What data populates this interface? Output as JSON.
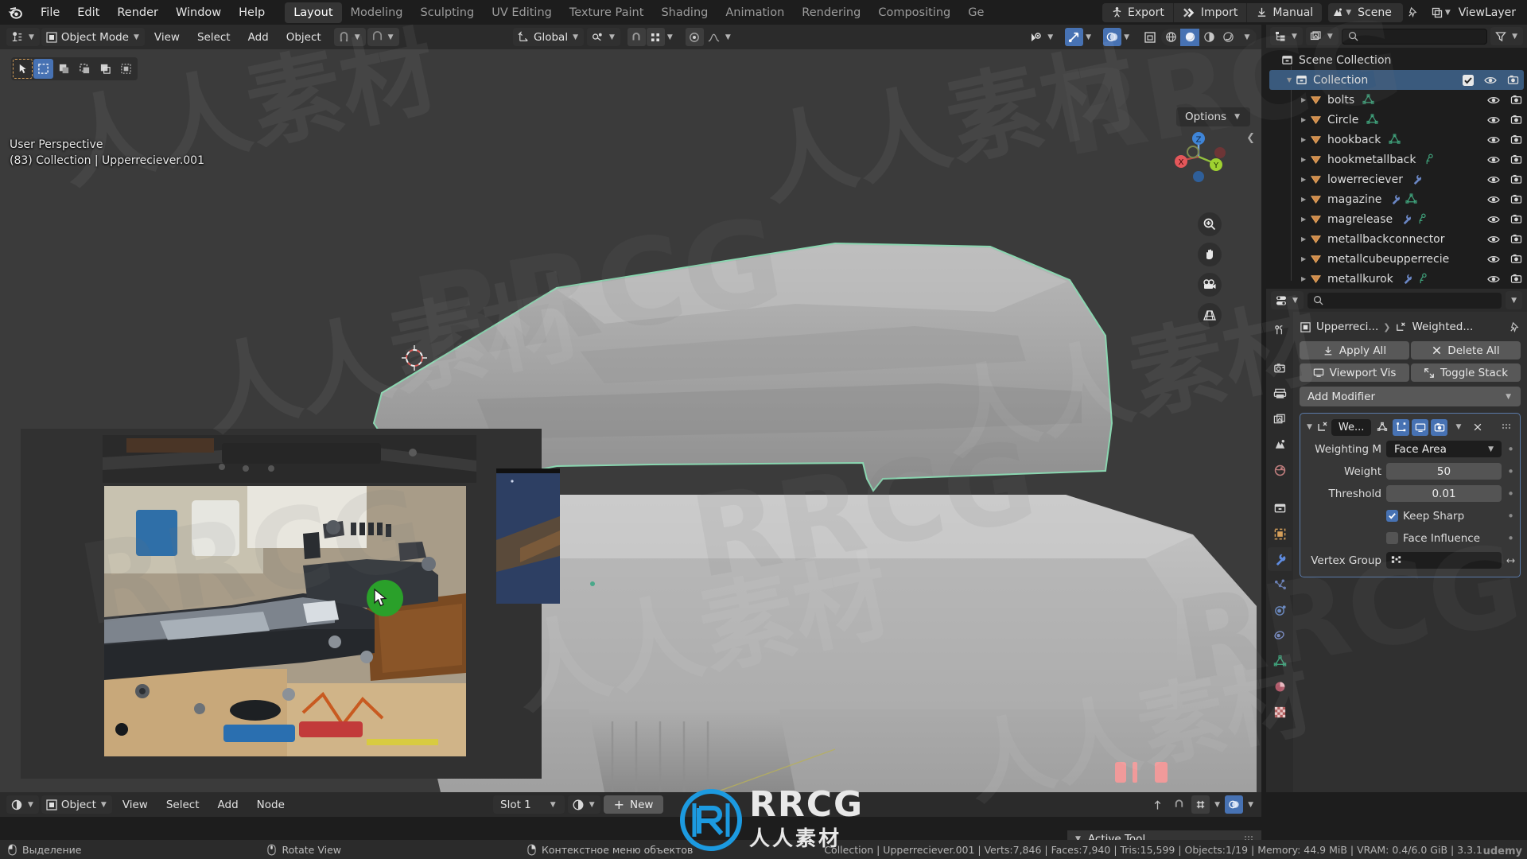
{
  "topbar": {
    "menus": [
      "File",
      "Edit",
      "Render",
      "Window",
      "Help"
    ],
    "workspaces": [
      {
        "label": "Layout",
        "active": true
      },
      {
        "label": "Modeling",
        "active": false
      },
      {
        "label": "Sculpting",
        "active": false
      },
      {
        "label": "UV Editing",
        "active": false
      },
      {
        "label": "Texture Paint",
        "active": false
      },
      {
        "label": "Shading",
        "active": false
      },
      {
        "label": "Animation",
        "active": false
      },
      {
        "label": "Rendering",
        "active": false
      },
      {
        "label": "Compositing",
        "active": false
      },
      {
        "label": "Ge",
        "active": false
      }
    ],
    "export_label": "Export",
    "import_label": "Import",
    "manual_label": "Manual",
    "scene_name": "Scene",
    "viewlayer_name": "ViewLayer",
    "logo_alt": "blender-logo"
  },
  "viewport_header": {
    "mode": "Object Mode",
    "menus": [
      "View",
      "Select",
      "Add",
      "Object"
    ],
    "transform_orientation": "Global",
    "options_label": "Options"
  },
  "viewport": {
    "perspective_label": "User Perspective",
    "scene_object_label": "(83) Collection | Upperreciever.001"
  },
  "outliner": {
    "scene_collection": "Scene Collection",
    "items": [
      {
        "label": "Collection",
        "indent": 0,
        "expanded": true,
        "checkbox": true,
        "type": "collection",
        "icons": [],
        "eye": true,
        "camera": true
      },
      {
        "label": "bolts",
        "indent": 1,
        "expanded": false,
        "type": "object",
        "icons": [
          "mesh"
        ],
        "eye": true,
        "camera": true
      },
      {
        "label": "Circle",
        "indent": 1,
        "expanded": false,
        "type": "object",
        "icons": [
          "mesh"
        ],
        "eye": true,
        "camera": true
      },
      {
        "label": "hookback",
        "indent": 1,
        "expanded": false,
        "type": "object",
        "icons": [
          "mesh"
        ],
        "eye": true,
        "camera": true
      },
      {
        "label": "hookmetallback",
        "indent": 1,
        "expanded": false,
        "type": "object",
        "icons": [
          "mod"
        ],
        "eye": true,
        "camera": true
      },
      {
        "label": "lowerreciever",
        "indent": 1,
        "expanded": false,
        "type": "object",
        "icons": [
          "wrench"
        ],
        "eye": true,
        "camera": true
      },
      {
        "label": "magazine",
        "indent": 1,
        "expanded": false,
        "type": "object",
        "icons": [
          "wrench",
          "mesh"
        ],
        "eye": true,
        "camera": true
      },
      {
        "label": "magrelease",
        "indent": 1,
        "expanded": false,
        "type": "object",
        "icons": [
          "wrench",
          "mod"
        ],
        "eye": true,
        "camera": true
      },
      {
        "label": "metallbackconnector",
        "indent": 1,
        "expanded": false,
        "type": "object",
        "icons": [],
        "eye": true,
        "camera": true
      },
      {
        "label": "metallcubeupperrecie",
        "indent": 1,
        "expanded": false,
        "type": "object",
        "icons": [],
        "eye": true,
        "camera": true
      },
      {
        "label": "metallkurok",
        "indent": 1,
        "expanded": false,
        "type": "object",
        "icons": [
          "wrench",
          "mod"
        ],
        "eye": true,
        "camera": true
      }
    ]
  },
  "properties": {
    "breadcrumb_object": "Upperreci...",
    "breadcrumb_modifier": "Weighted...",
    "apply_all": "Apply All",
    "delete_all": "Delete All",
    "viewport_vis": "Viewport Vis",
    "toggle_stack": "Toggle Stack",
    "add_modifier": "Add Modifier",
    "modifier": {
      "name": "We...",
      "fields": [
        {
          "label": "Weighting M",
          "value": "Face Area",
          "kind": "dropdown"
        },
        {
          "label": "Weight",
          "value": "50",
          "kind": "slider"
        },
        {
          "label": "Threshold",
          "value": "0.01",
          "kind": "slider"
        }
      ],
      "checkboxes": [
        {
          "label": "Keep Sharp",
          "checked": true
        },
        {
          "label": "Face Influence",
          "checked": false
        }
      ],
      "vertex_group_label": "Vertex Group",
      "vertex_group_value": ""
    },
    "tabs": [
      "tool-icon",
      "render-icon",
      "output-icon",
      "view-layer-icon",
      "scene-icon",
      "world-icon",
      "collection-icon",
      "object-icon",
      "modifier-wrench-icon",
      "particles-icon",
      "physics-icon",
      "constraints-icon",
      "data-mesh-icon",
      "material-icon",
      "texture-icon"
    ]
  },
  "shader_editor": {
    "mode": "Object",
    "menus": [
      "View",
      "Select",
      "Add",
      "Node"
    ],
    "slot": "Slot 1",
    "new_label": "New"
  },
  "active_tool_panel": {
    "title": "Active Tool"
  },
  "status_bar": {
    "mouse_hints": [
      {
        "label": "Выделение"
      },
      {
        "label": "Rotate View"
      },
      {
        "label": "Контекстное меню объектов"
      }
    ],
    "stats": "Collection | Upperreciever.001 | Verts:7,846 | Faces:7,940 | Tris:15,599 | Objects:1/19 | Memory: 44.9 MiB | VRAM: 0.4/6.0 GiB | 3.3.1"
  },
  "watermarks": {
    "brand": "RRCG",
    "sub": "人人素材",
    "udemy": "udemy"
  },
  "colors": {
    "accent_blue": "#4772b3",
    "orange": "#d59f5a",
    "selection_green": "#8ad6b0",
    "panel_bg": "#303030",
    "viewport_bg": "#3b3b3b",
    "header_bg": "#2b2b2b",
    "dark_bg": "#1d1d1d"
  }
}
